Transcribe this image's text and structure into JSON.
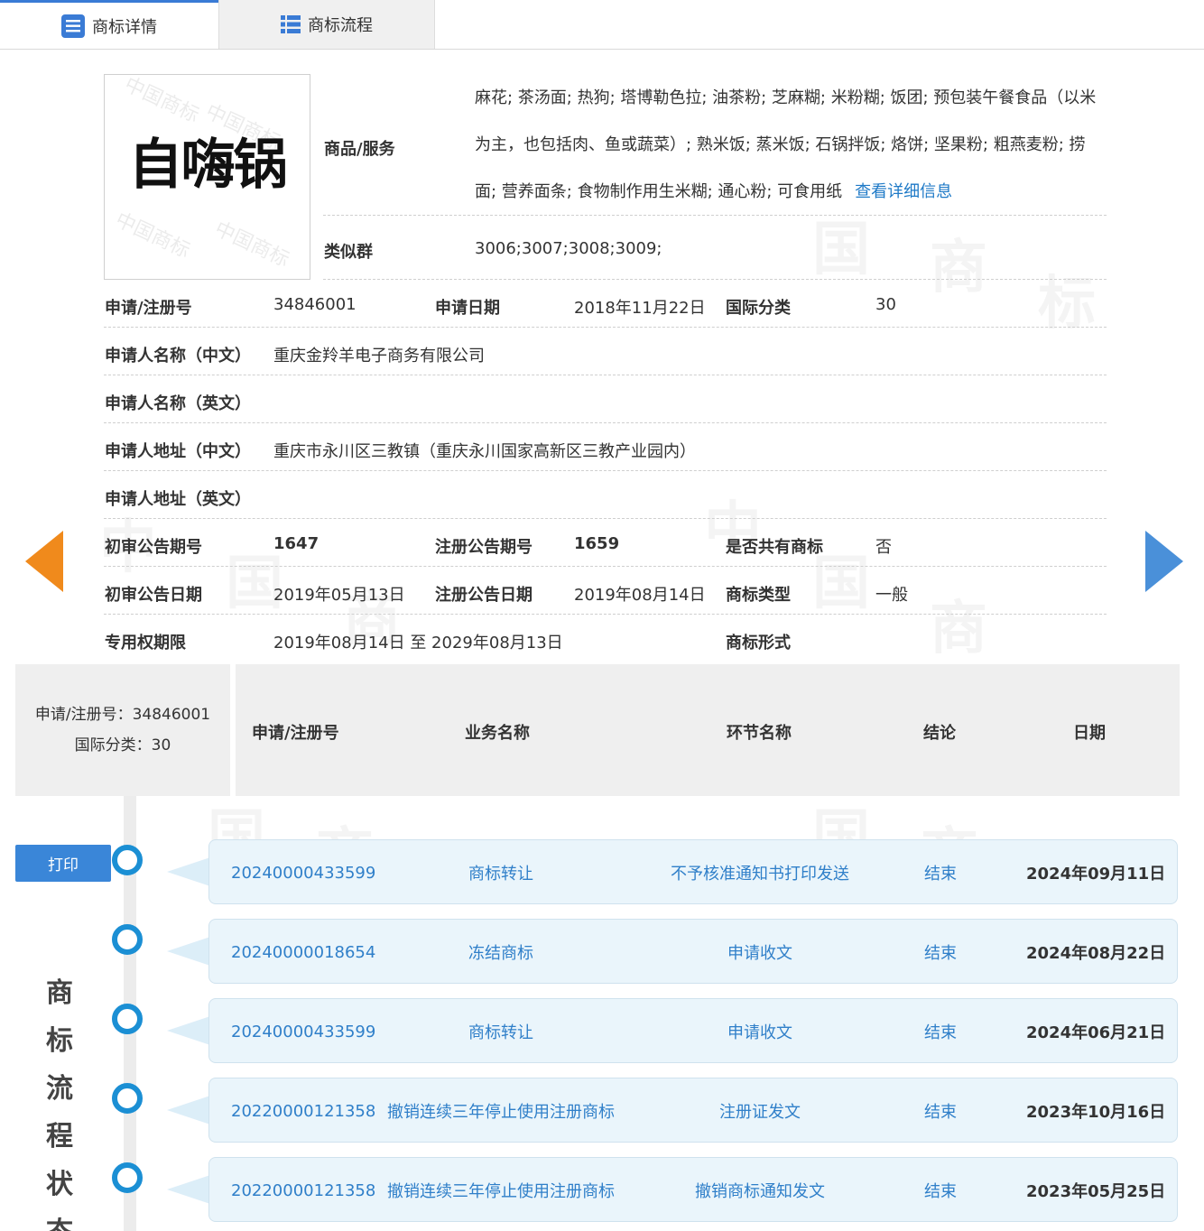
{
  "tabs": [
    {
      "label": "商标详情",
      "icon": "list-detail-icon",
      "active": true
    },
    {
      "label": "商标流程",
      "icon": "list-bullets-icon",
      "active": false
    }
  ],
  "detail": {
    "logo_text": "自嗨锅",
    "goods_label": "商品/服务",
    "goods_text": "麻花; 茶汤面; 热狗; 塔博勒色拉; 油茶粉; 芝麻糊; 米粉糊; 饭团; 预包装午餐食品（以米为主，也包括肉、鱼或蔬菜）; 熟米饭; 蒸米饭; 石锅拌饭; 烙饼; 坚果粉; 粗燕麦粉; 捞面; 营养面条; 食物制作用生米糊; 通心粉; 可食用纸",
    "goods_more": "查看详细信息",
    "similar_label": "类似群",
    "similar_value": "3006;3007;3008;3009;",
    "reg_no_label": "申请/注册号",
    "reg_no": "34846001",
    "apply_date_label": "申请日期",
    "apply_date": "2018年11月22日",
    "intl_class_label": "国际分类",
    "intl_class": "30",
    "applicant_cn_label": "申请人名称（中文）",
    "applicant_cn": "重庆金羚羊电子商务有限公司",
    "applicant_en_label": "申请人名称（英文）",
    "applicant_en": "",
    "address_cn_label": "申请人地址（中文）",
    "address_cn": "重庆市永川区三教镇（重庆永川国家高新区三教产业园内）",
    "address_en_label": "申请人地址（英文）",
    "address_en": "",
    "prelim_no_label": "初审公告期号",
    "prelim_no": "1647",
    "reg_pub_no_label": "注册公告期号",
    "reg_pub_no": "1659",
    "shared_label": "是否共有商标",
    "shared": "否",
    "prelim_date_label": "初审公告日期",
    "prelim_date": "2019年05月13日",
    "reg_pub_date_label": "注册公告日期",
    "reg_pub_date": "2019年08月14日",
    "tm_type_label": "商标类型",
    "tm_type": "一般",
    "term_label": "专用权期限",
    "term": "2019年08月14日 至 2029年08月13日",
    "tm_form_label": "商标形式",
    "tm_form": ""
  },
  "flow": {
    "summary_reg": "申请/注册号：34846001",
    "summary_class": "国际分类：30",
    "headers": [
      "申请/注册号",
      "业务名称",
      "环节名称",
      "结论",
      "日期"
    ],
    "print_label": "打印",
    "side_title": "商标流程状态",
    "rows": [
      {
        "no": "20240000433599",
        "biz": "商标转让",
        "step": "不予核准通知书打印发送",
        "result": "结束",
        "date": "2024年09月11日"
      },
      {
        "no": "20240000018654",
        "biz": "冻结商标",
        "step": "申请收文",
        "result": "结束",
        "date": "2024年08月22日"
      },
      {
        "no": "20240000433599",
        "biz": "商标转让",
        "step": "申请收文",
        "result": "结束",
        "date": "2024年06月21日"
      },
      {
        "no": "20220000121358",
        "biz": "撤销连续三年停止使用注册商标",
        "step": "注册证发文",
        "result": "结束",
        "date": "2023年10月16日"
      },
      {
        "no": "20220000121358",
        "biz": "撤销连续三年停止使用注册商标",
        "step": "撤销商标通知发文",
        "result": "结束",
        "date": "2023年05月25日"
      }
    ]
  },
  "colors": {
    "link": "#2f7fc9",
    "timeline_dot": "#1b8fd4",
    "arrow_prev": "#f08a1c",
    "arrow_next": "#4a90d9",
    "print_button": "#3a86d8"
  }
}
